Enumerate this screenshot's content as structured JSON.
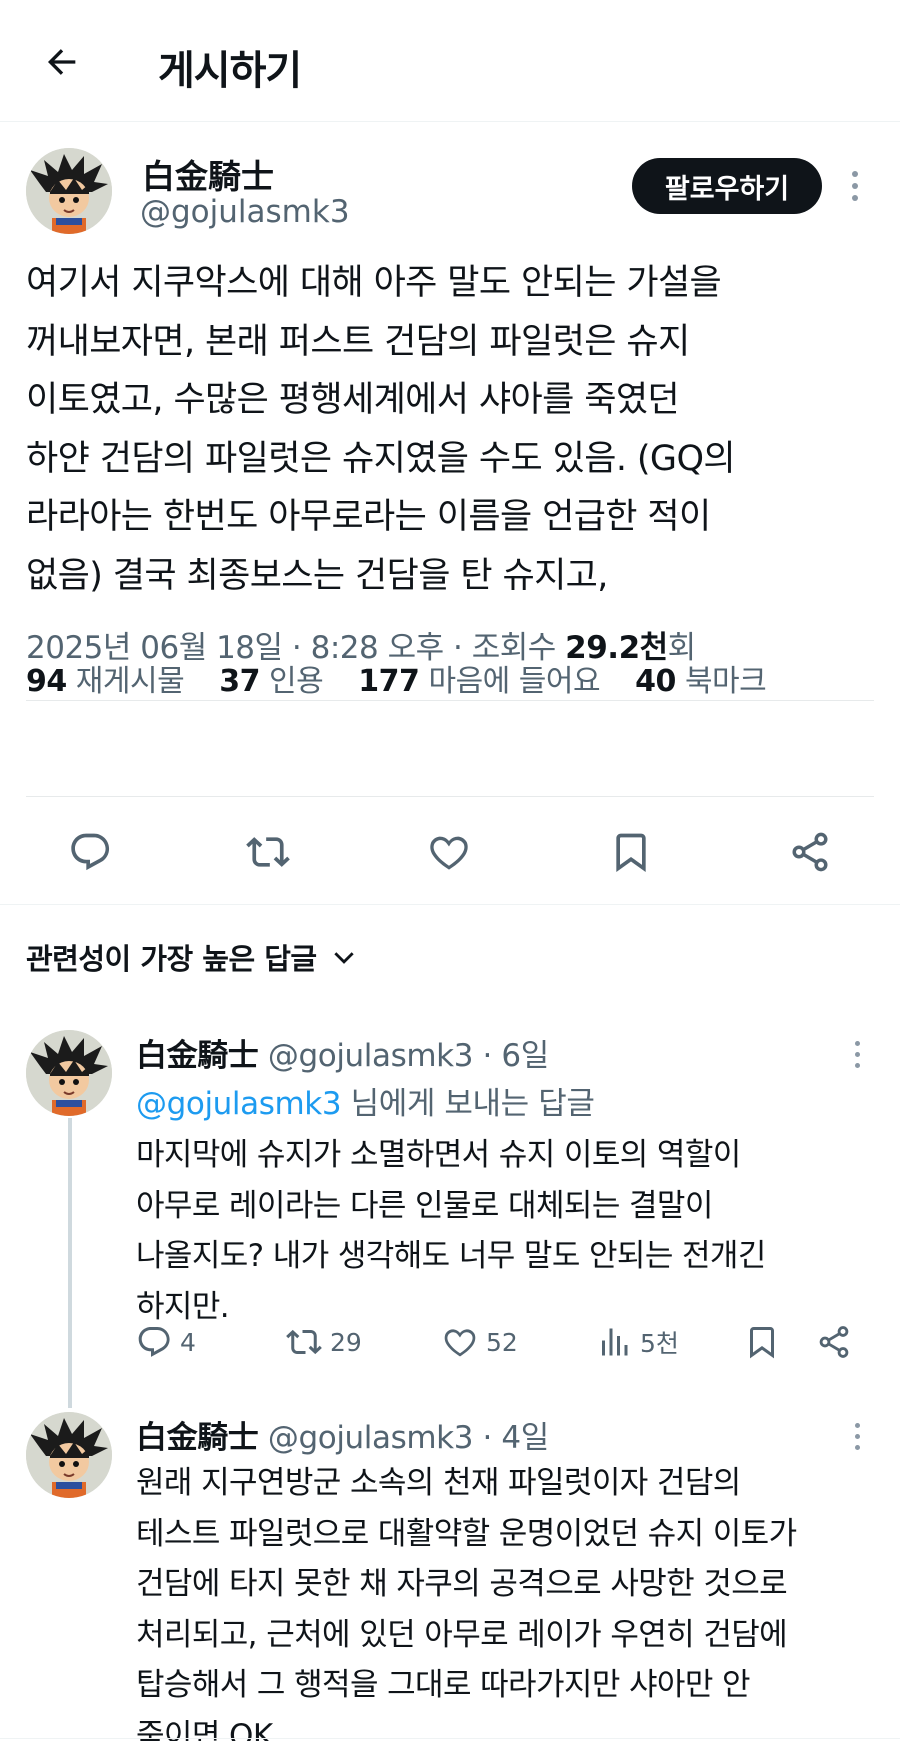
{
  "header": {
    "title": "게시하기"
  },
  "post": {
    "author_name": "白金騎士",
    "author_handle": "@gojulasmk3",
    "follow_label": "팔로우하기",
    "text": "여기서 지쿠악스에 대해 아주 말도 안되는 가설을\n꺼내보자면, 본래 퍼스트 건담의 파일럿은 슈지\n이토였고, 수많은 평행세계에서 샤아를 죽였던\n하얀 건담의 파일럿은 슈지였을 수도 있음. (GQ의\n라라아는 한번도 아무로라는 이름을 언급한 적이\n없음) 결국 최종보스는 건담을 탄 슈지고,",
    "date": "2025년 06월 18일",
    "time": "8:28 오후",
    "views_label": "조회수",
    "views_count": "29.2천",
    "views_suffix": "회",
    "stats": {
      "reposts": "94",
      "reposts_label": "재게시물",
      "quotes": "37",
      "quotes_label": "인용",
      "likes": "177",
      "likes_label": "마음에 들어요",
      "bookmarks": "40",
      "bookmarks_label": "북마크"
    }
  },
  "replies_sort": {
    "label": "관련성이 가장 높은 답글"
  },
  "replies": [
    {
      "author_name": "白金騎士",
      "author_handle": "@gojulasmk3",
      "age": "6일",
      "reply_to_handle": "@gojulasmk3",
      "reply_to_suffix": "님에게 보내는 답글",
      "text": "마지막에 슈지가 소멸하면서 슈지 이토의 역할이\n아무로 레이라는 다른 인물로 대체되는 결말이\n나올지도? 내가 생각해도 너무 말도 안되는 전개긴\n하지만.",
      "replies": "4",
      "reposts": "29",
      "likes": "52",
      "views": "5천"
    },
    {
      "author_name": "白金騎士",
      "author_handle": "@gojulasmk3",
      "age": "4일",
      "text": "원래 지구연방군 소속의 천재 파일럿이자 건담의\n테스트 파일럿으로 대활약할 운명이었던 슈지 이토가\n건담에 타지 못한 채 자쿠의 공격으로 사망한 것으로\n처리되고, 근처에 있던 아무로 레이가 우연히 건담에\n탑승해서 그 행적을 그대로 따라가지만 샤아만 안\n죽이면 OK."
    }
  ]
}
